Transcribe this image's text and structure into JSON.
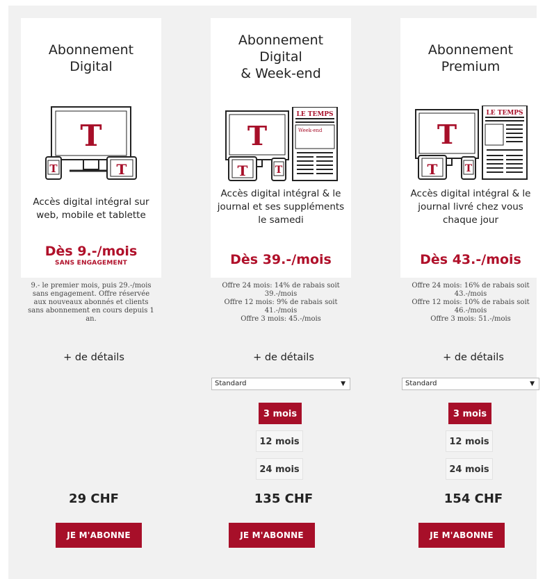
{
  "colors": {
    "accent": "#a70f29",
    "price_red": "#b0102a",
    "page_bg": "#f1f1f1"
  },
  "plans": [
    {
      "title": "Abonnement\nDigital",
      "icon": "devices-digital-icon",
      "description": "Accès digital intégral sur\nweb, mobile et tablette",
      "price": "Dès 9.-/mois",
      "price_sub": "SANS ENGAGEMENT",
      "note": "9.- le premier mois, puis 29.-/mois\nsans engagement. Offre réservée\naux nouveaux abonnés et clients\nsans abonnement en cours depuis 1\nan.",
      "details": "+ de détails",
      "total": "29 CHF",
      "cta": "JE M'ABONNE"
    },
    {
      "title": "Abonnement\nDigital\n& Week-end",
      "icon": "devices-weekend-newspaper-icon",
      "description": "Accès digital intégral & le\njournal et ses suppléments\nle samedi",
      "price": "Dès 39.-/mois",
      "note": "Offre 24 mois: 14% de rabais soit\n39.-/mois\nOffre 12 mois: 9% de rabais soit\n41.-/mois\nOffre 3 mois: 45.-/mois",
      "details": "+ de détails",
      "select_value": "Standard",
      "durations": [
        "3 mois",
        "12 mois",
        "24 mois"
      ],
      "active_duration": 0,
      "total": "135 CHF",
      "cta": "JE M'ABONNE"
    },
    {
      "title": "Abonnement\nPremium",
      "icon": "devices-premium-newspaper-icon",
      "description": "Accès digital intégral & le\njournal livré chez vous\nchaque jour",
      "price": "Dès 43.-/mois",
      "note": "Offre 24 mois: 16% de rabais soit\n43.-/mois\nOffre 12 mois: 10% de rabais soit\n46.-/mois\nOffre 3 mois: 51.-/mois",
      "details": "+ de détails",
      "select_value": "Standard",
      "durations": [
        "3 mois",
        "12 mois",
        "24 mois"
      ],
      "active_duration": 0,
      "total": "154 CHF",
      "cta": "JE M'ABONNE"
    }
  ],
  "logo_letter": "T",
  "newspaper_masthead": "LE TEMPS",
  "weekend_label": "Week-end"
}
